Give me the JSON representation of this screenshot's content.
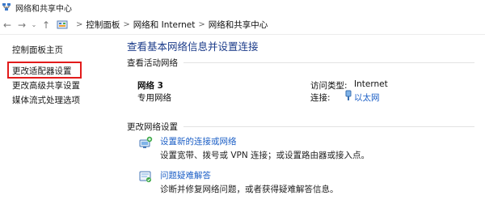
{
  "window": {
    "title": "网络和共享中心"
  },
  "address_bar": {
    "breadcrumbs": [
      "控制面板",
      "网络和 Internet",
      "网络和共享中心"
    ],
    "separator": ">"
  },
  "sidebar": {
    "items": [
      {
        "label": "控制面板主页"
      },
      {
        "label": "更改适配器设置"
      },
      {
        "label": "更改高级共享设置"
      },
      {
        "label": "媒体流式处理选项"
      }
    ]
  },
  "main": {
    "title": "查看基本网络信息并设置连接",
    "active_section": {
      "header": "查看活动网络",
      "network_name": "网络 3",
      "network_type": "专用网络",
      "access_type_label": "访问类型:",
      "access_type_value": "Internet",
      "connections_label": "连接:",
      "connections_value": "以太网"
    },
    "change_section": {
      "header": "更改网络设置",
      "tasks": [
        {
          "link": "设置新的连接或网络",
          "desc": "设置宽带、拨号或 VPN 连接；或设置路由器或接入点。"
        },
        {
          "link": "问题疑难解答",
          "desc": "诊断并修复网络问题，或者获得疑难解答信息。"
        }
      ]
    }
  },
  "colors": {
    "link": "#1c5fc6",
    "title": "#1c3c8a",
    "highlight": "#e21b1b"
  }
}
